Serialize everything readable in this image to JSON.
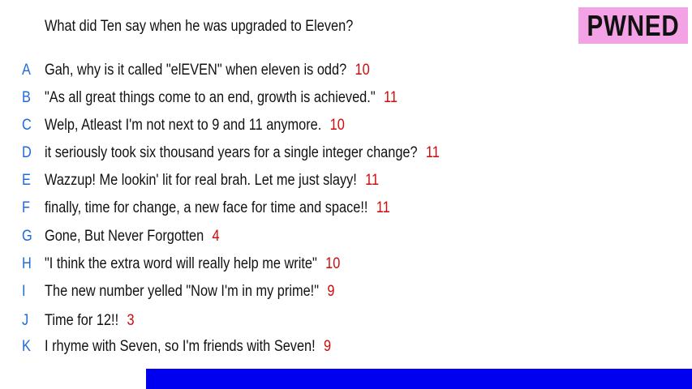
{
  "question": "What did Ten say when he was upgraded to Eleven?",
  "logo_text": "PWNED",
  "colors": {
    "letter": "#1e6bd6",
    "score": "#d10a0a",
    "logo_bg": "#f3a3e5",
    "bar": "#0000f0"
  },
  "answers": [
    {
      "letter": "A",
      "text": "Gah, why is it called \"elEVEN\" when eleven is odd?",
      "score": "10"
    },
    {
      "letter": "B",
      "text": "\"As all great things come to an end, growth is achieved.\"",
      "score": "11"
    },
    {
      "letter": "C",
      "text": "Welp, Atleast I'm not next to 9 and 11 anymore.",
      "score": "10"
    },
    {
      "letter": "D",
      "text": "it seriously took six thousand years for a single integer change?",
      "score": "11"
    },
    {
      "letter": "E",
      "text": "Wazzup! Me lookin' lit for real brah. Let me just slayy!",
      "score": "11"
    },
    {
      "letter": "F",
      "text": "finally, time for change, a new face for time and space!!",
      "score": "11"
    },
    {
      "letter": "G",
      "text": "Gone, But Never Forgotten",
      "score": "4"
    },
    {
      "letter": "H",
      "text": "\"I think the extra word will really help me write\"",
      "score": "10"
    },
    {
      "letter": "I",
      "text": "The new number yelled \"Now I'm in my prime!\"",
      "score": "9"
    },
    {
      "letter": "J",
      "text": "Time for 12!!",
      "score": "3"
    },
    {
      "letter": "K",
      "text": "I rhyme with Seven, so I'm friends with Seven!",
      "score": "9"
    }
  ]
}
